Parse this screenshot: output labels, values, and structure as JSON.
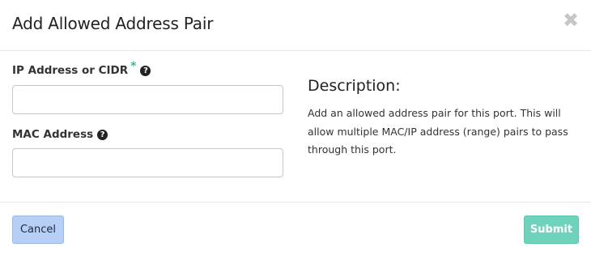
{
  "modal": {
    "title": "Add Allowed Address Pair",
    "close_glyph": "✖",
    "close_icon": "close-icon"
  },
  "form": {
    "ip_field": {
      "label": "IP Address or CIDR",
      "required_marker": "*",
      "help_glyph": "?",
      "value": "",
      "placeholder": ""
    },
    "mac_field": {
      "label": "MAC Address",
      "help_glyph": "?",
      "value": "",
      "placeholder": ""
    }
  },
  "description": {
    "title": "Description:",
    "text": "Add an allowed address pair for this port. This will allow multiple MAC/IP address (range) pairs to pass through this port."
  },
  "footer": {
    "cancel_label": "Cancel",
    "submit_label": "Submit"
  },
  "colors": {
    "required_star": "#35b89a",
    "cancel_bg": "#b7cef5",
    "submit_bg": "#6fd3bb"
  }
}
